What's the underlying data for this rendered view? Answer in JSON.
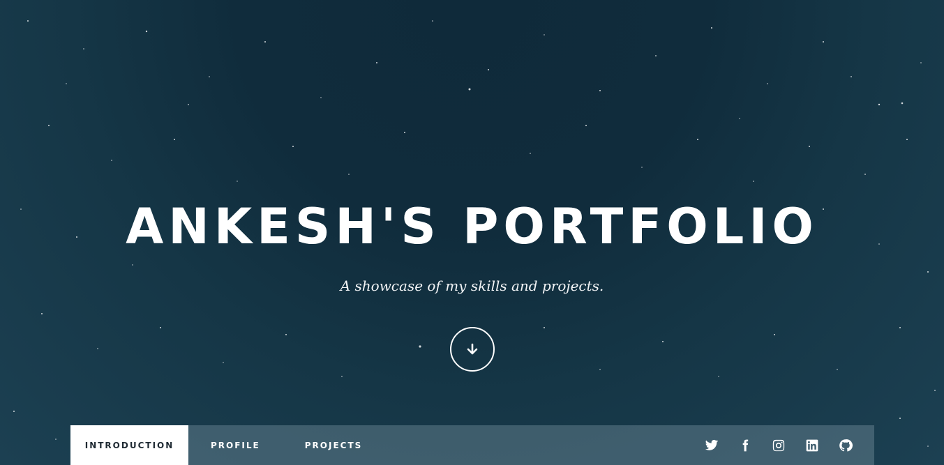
{
  "hero": {
    "title": "ANKESH'S PORTFOLIO",
    "subtitle": "A showcase of my skills and projects."
  },
  "scroll_button": {
    "icon": "arrow-down-icon"
  },
  "nav": {
    "items": [
      {
        "label": "INTRODUCTION",
        "active": true
      },
      {
        "label": "PROFILE",
        "active": false
      },
      {
        "label": "PROJECTS",
        "active": false
      }
    ],
    "social": [
      {
        "icon": "twitter-icon"
      },
      {
        "icon": "facebook-icon"
      },
      {
        "icon": "instagram-icon"
      },
      {
        "icon": "linkedin-icon"
      },
      {
        "icon": "github-icon"
      }
    ]
  },
  "colors": {
    "background": "#122f3f",
    "nav_background": "#7891a0",
    "active_tab_bg": "#ffffff",
    "active_tab_text": "#1f2a33",
    "text": "#ffffff"
  }
}
